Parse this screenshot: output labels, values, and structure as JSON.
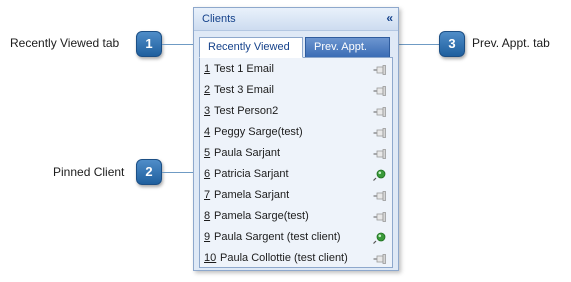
{
  "panel": {
    "title": "Clients",
    "collapse_glyph": "«",
    "tabs": [
      {
        "label": "Recently Viewed",
        "active": true
      },
      {
        "label": "Prev. Appt.",
        "active": false
      }
    ],
    "items": [
      {
        "num": "1",
        "name": "Test 1 Email",
        "pinned": false
      },
      {
        "num": "2",
        "name": "Test 3 Email",
        "pinned": false
      },
      {
        "num": "3",
        "name": "Test Person2",
        "pinned": false
      },
      {
        "num": "4",
        "name": "Peggy Sarge(test)",
        "pinned": false
      },
      {
        "num": "5",
        "name": "Paula Sarjant",
        "pinned": false
      },
      {
        "num": "6",
        "name": "Patricia Sarjant",
        "pinned": true
      },
      {
        "num": "7",
        "name": "Pamela Sarjant",
        "pinned": false
      },
      {
        "num": "8",
        "name": "Pamela Sarge(test)",
        "pinned": false
      },
      {
        "num": "9",
        "name": "Paula Sargent (test client)",
        "pinned": true
      },
      {
        "num": "10",
        "name": "Paula Collottie (test client)",
        "pinned": false
      }
    ]
  },
  "callouts": [
    {
      "number": "1",
      "label": "Recently Viewed tab"
    },
    {
      "number": "2",
      "label": "Pinned Client"
    },
    {
      "number": "3",
      "label": "Prev. Appt. tab"
    }
  ],
  "colors": {
    "accent": "#1f5f9e",
    "pinned": "#3a9a3a",
    "unpinned": "#9a9a9a"
  }
}
